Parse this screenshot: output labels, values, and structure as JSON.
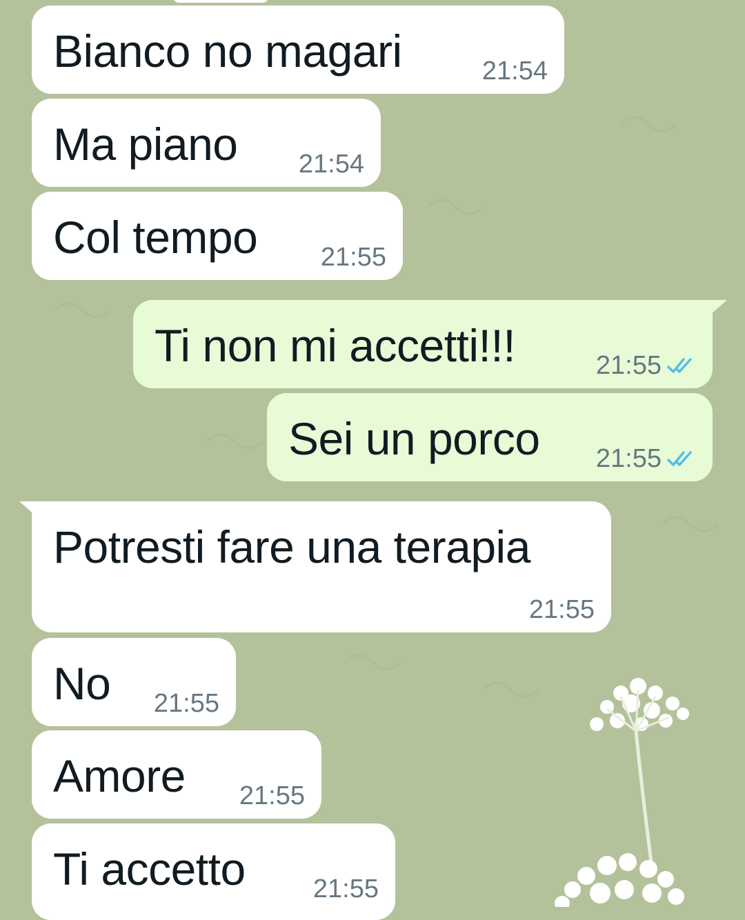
{
  "messages": [
    {
      "text": "Bianco no magari",
      "time": "21:54",
      "direction": "incoming"
    },
    {
      "text": "Ma piano",
      "time": "21:54",
      "direction": "incoming"
    },
    {
      "text": "Col tempo",
      "time": "21:55",
      "direction": "incoming"
    },
    {
      "text": "Ti non mi accetti!!!",
      "time": "21:55",
      "direction": "outgoing",
      "status": "read"
    },
    {
      "text": "Sei un porco",
      "time": "21:55",
      "direction": "outgoing",
      "status": "read"
    },
    {
      "text": "Potresti fare una terapia",
      "time": "21:55",
      "direction": "incoming"
    },
    {
      "text": "No",
      "time": "21:55",
      "direction": "incoming"
    },
    {
      "text": "Amore",
      "time": "21:55",
      "direction": "incoming"
    },
    {
      "text": "Ti accetto",
      "time": "21:55",
      "direction": "incoming"
    }
  ],
  "colors": {
    "background": "#b3c29a",
    "incoming_bubble": "#ffffff",
    "outgoing_bubble": "#e7fcd6",
    "read_tick": "#53bdeb",
    "timestamp": "#667781"
  },
  "icons": {
    "read_receipt": "double-check-icon",
    "wallpaper": "flower-illustration"
  }
}
